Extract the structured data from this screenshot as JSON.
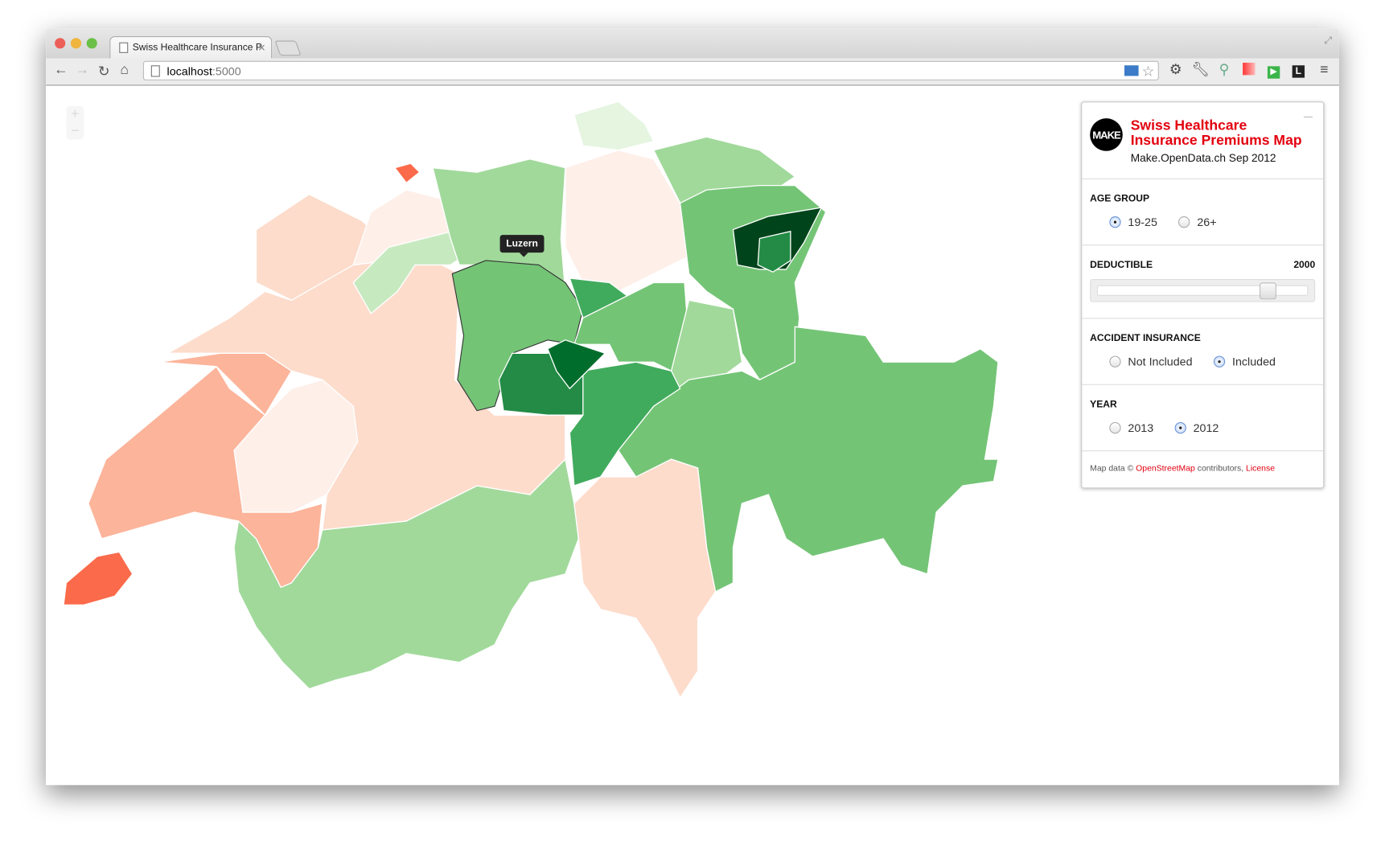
{
  "browser": {
    "tab_title": "Swiss Healthcare Insurance P",
    "url_host": "localhost",
    "url_port": ":5000"
  },
  "map": {
    "zoom_in": "+",
    "zoom_out": "−",
    "tooltip": "Luzern",
    "colors": {
      "red_strong": "#fb6a4a",
      "red_medium": "#fcb49a",
      "red_light": "#fddccc",
      "red_pale": "#feefe9",
      "green_pale": "#e5f5e0",
      "green_light": "#c7e9c0",
      "green_medium_light": "#a1d99b",
      "green_medium": "#74c476",
      "green_mid_dark": "#41ab5d",
      "green_dark": "#238b45",
      "green_darker": "#006d2c",
      "green_darkest": "#00441b"
    }
  },
  "panel": {
    "logo": "MAKE",
    "title": "Swiss Healthcare Insurance Premiums Map",
    "subtitle": "Make.OpenData.ch Sep 2012",
    "age_group": {
      "label": "AGE GROUP",
      "options": [
        "19-25",
        "26+"
      ],
      "selected": "19-25"
    },
    "deductible": {
      "label": "DEDUCTIBLE",
      "value": "2000",
      "slider_fraction": 0.8
    },
    "accident": {
      "label": "ACCIDENT INSURANCE",
      "options": [
        "Not Included",
        "Included"
      ],
      "selected": "Included"
    },
    "year": {
      "label": "YEAR",
      "options": [
        "2013",
        "2012"
      ],
      "selected": "2012"
    },
    "footer": {
      "prefix": "Map data ©",
      "osm": "OpenStreetMap",
      "middle": "contributors,",
      "license": "License"
    }
  }
}
